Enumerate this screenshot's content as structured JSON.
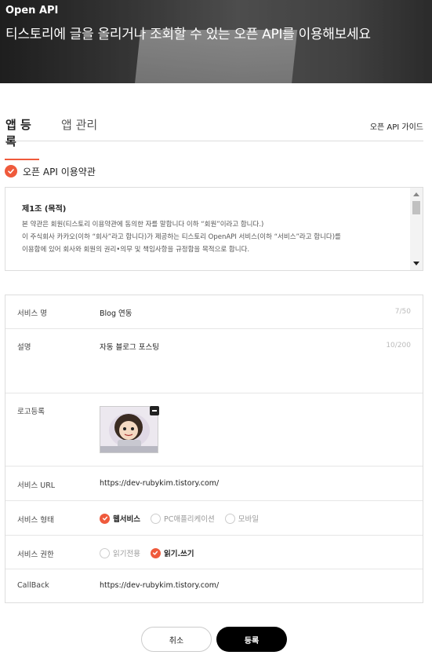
{
  "hero": {
    "label": "Open API",
    "title": "티스토리에 글을 올리거나 조회할 수 있는 오픈 API를 이용해보세요"
  },
  "tabs": {
    "register": "앱 등록",
    "manage": "앱 관리",
    "guide": "오픈 API 가이드"
  },
  "terms": {
    "title": "오픈 API 이용약관",
    "article": "제1조 (목적)",
    "lines": [
      "본 약관은 회원(티스토리 이용약관에 동의한 자를 말합니다 이하 “회원”이라고 합니다.)",
      "이 주식회사 카카오(이하 “회사”라고 합니다)가 제공하는 티스토리 OpenAPI 서비스(이하 “서비스”라고 합니다)를",
      "이용함에 있어 회사와 회원의 권리•의무 및 책임사항을 규정함을 목적으로 합니다."
    ]
  },
  "form": {
    "service_name": {
      "label": "서비스 명",
      "value": "Blog 연동",
      "counter": "7/50"
    },
    "description": {
      "label": "설명",
      "value": "자동 블로그 포스팅",
      "counter": "10/200"
    },
    "logo": {
      "label": "로고등록"
    },
    "service_url": {
      "label": "서비스 URL",
      "value": "https://dev-rubykim.tistory.com/"
    },
    "service_type": {
      "label": "서비스 형태",
      "options": [
        "웹서비스",
        "PC애플리케이션",
        "모바일"
      ],
      "selected": "웹서비스"
    },
    "permission": {
      "label": "서비스 권한",
      "options": [
        "읽기전용",
        "읽기.쓰기"
      ],
      "selected": "읽기.쓰기"
    },
    "callback": {
      "label": "CallBack",
      "value": "https://dev-rubykim.tistory.com/"
    }
  },
  "buttons": {
    "cancel": "취소",
    "submit": "등록"
  },
  "colors": {
    "accent": "#ef5a3c",
    "primary_button": "#000000"
  }
}
